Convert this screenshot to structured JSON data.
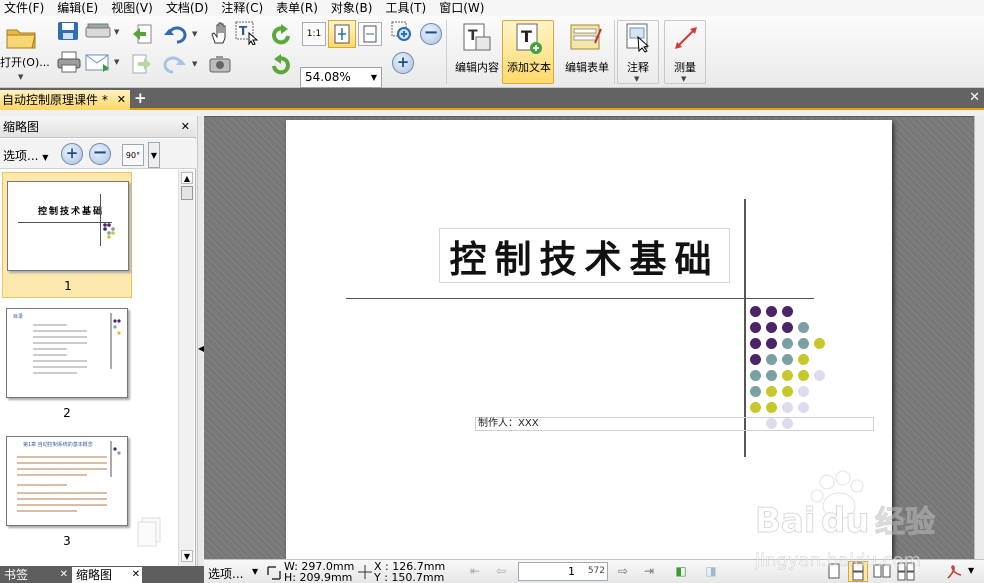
{
  "menu": [
    "文件(F)",
    "编辑(E)",
    "视图(V)",
    "文档(D)",
    "注释(C)",
    "表单(R)",
    "对象(B)",
    "工具(T)",
    "窗口(W)"
  ],
  "toolbar": {
    "open_label": "打开(O)...",
    "zoom_value": "54.08%",
    "fit_icons": [
      "1:1",
      "fit-page",
      "fit-width"
    ],
    "big_buttons": [
      "编辑内容",
      "添加文本",
      "编辑表单",
      "注释",
      "测量"
    ]
  },
  "tabs": {
    "doc_tab": "自动控制原理课件 *"
  },
  "left_panel": {
    "title": "缩略图",
    "options_label": "选项...",
    "rotate_label": "90°",
    "thumbnails": [
      {
        "num": "1",
        "title": "控制技术基础"
      },
      {
        "num": "2",
        "title": "目录"
      },
      {
        "num": "3",
        "title": "第1章 自动控制系统的基本概念"
      }
    ]
  },
  "bottom_tabs": [
    "书签",
    "缩略图"
  ],
  "document": {
    "title": "控制技术基础",
    "author": "制作人：XXX"
  },
  "status": {
    "options_label": "选项...",
    "width": "W: 297.0mm",
    "height": "H: 209.9mm",
    "x": "X : 126.7mm",
    "y": "Y : 150.7mm",
    "current_page": "1",
    "total_pages": "572"
  },
  "watermark": {
    "brand": "Baidu经验",
    "url": "jingyan.baidu.com"
  },
  "colors": {
    "purple": "#4b2468",
    "teal": "#7a9fa4",
    "yellow": "#c8c82c",
    "lavender": "#dedcec",
    "accent": "#e6a100"
  }
}
